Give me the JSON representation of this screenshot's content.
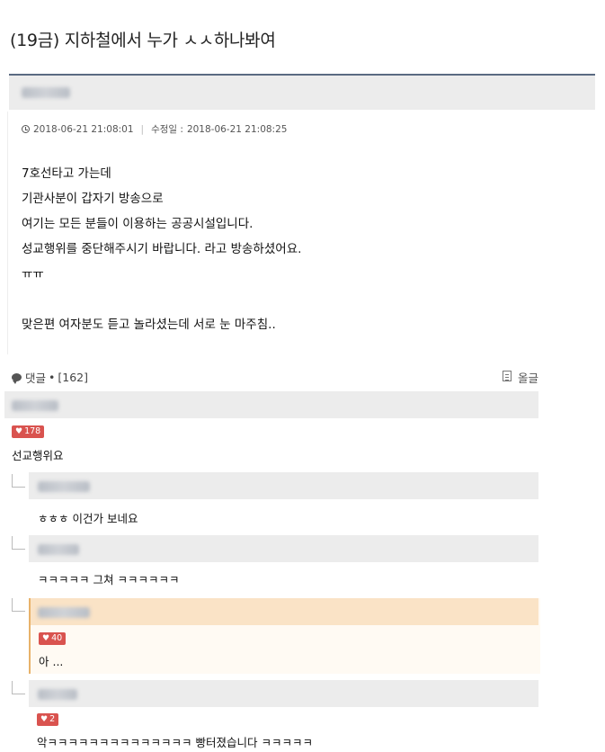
{
  "post": {
    "title": "(19금) 지하철에서 누가 ㅅㅅ하나봐여",
    "date": "2018-06-21 21:08:01",
    "modified_label": "수정일 :",
    "modified_date": "2018-06-21 21:08:25",
    "body": [
      "7호선타고 가는데",
      "기관사분이 갑자기 방송으로",
      "여기는 모든 분들이 이용하는 공공시설입니다.",
      "성교행위를 중단해주시기 바랍니다. 라고 방송하셨어요.",
      "ㅠㅠ",
      "맞은편 여자분도 듣고 놀라셨는데 서로 눈 마주침.."
    ]
  },
  "comments_bar": {
    "label": "댓글",
    "count": "[162]",
    "order_label": "올글"
  },
  "comments": [
    {
      "likes": "178",
      "text": "선교행위요"
    },
    {
      "text": "ㅎㅎㅎ 이건가 보네요"
    },
    {
      "text": "ㅋㅋㅋㅋㅋ 그쳐 ㅋㅋㅋㅋㅋㅋ"
    },
    {
      "likes": "40",
      "text": "아 ..."
    },
    {
      "likes": "2",
      "text": "악ㅋㅋㅋㅋㅋㅋㅋㅋㅋㅋㅋㅋㅋㅋ 빵터졌습니다 ㅋㅋㅋㅋㅋ"
    }
  ],
  "colors": {
    "header_border": "#5a6a82",
    "best_highlight": "#fae3c6",
    "like_badge": "#d9534f"
  },
  "icons": [
    "clock-icon",
    "speech-bubble-icon",
    "document-icon",
    "heart-icon"
  ]
}
